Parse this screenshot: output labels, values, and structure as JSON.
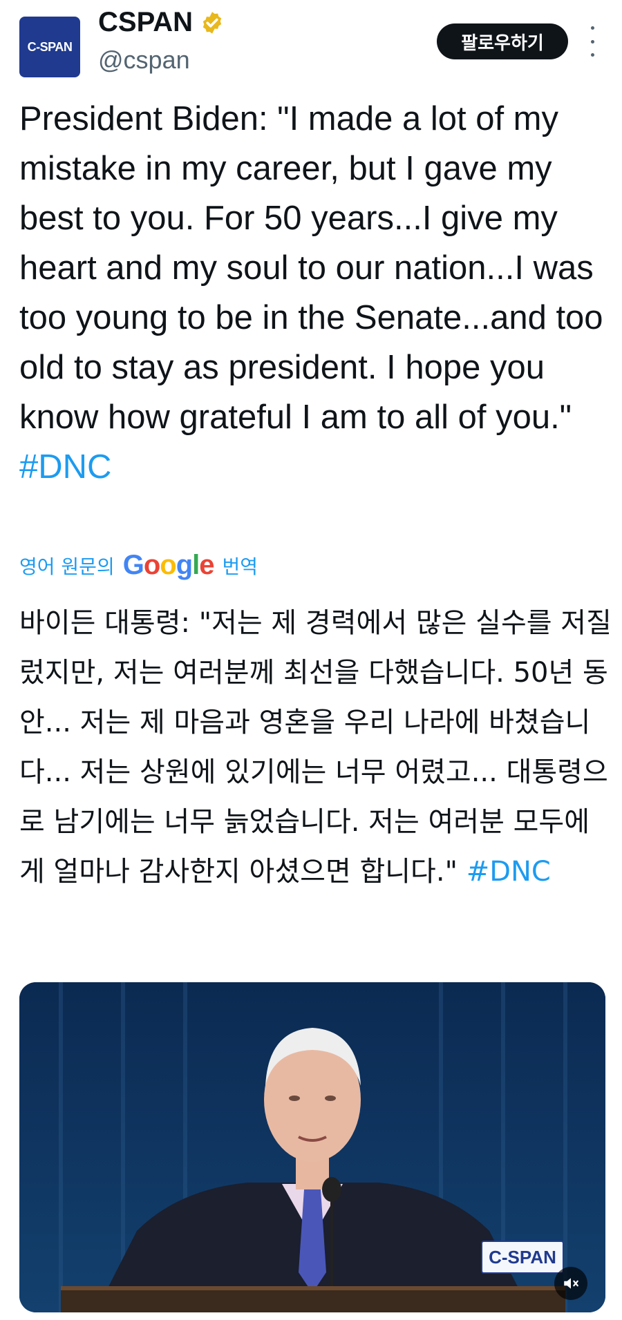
{
  "account": {
    "name": "CSPAN",
    "handle": "@cspan",
    "avatar_text": "C-SPAN",
    "verified_color": "#e8b81c"
  },
  "actions": {
    "follow_label": "팔로우하기"
  },
  "tweet": {
    "text_plain": "President Biden: \"I made a lot of my mistake in my career, but I gave my best to you. For 50 years...I give my heart and my soul to our nation...I was too young to be in the Senate...and too old to stay as president. I hope you know how grateful I am to all of you.\" ",
    "hashtag": "#DNC"
  },
  "translation": {
    "prefix": "영어 원문의",
    "google": "Google",
    "suffix": "번역",
    "text_plain": "바이든 대통령: \"저는 제 경력에서 많은 실수를 저질렀지만, 저는 여러분께 최선을 다했습니다. 50년 동안... 저는 제 마음과 영혼을 우리 나라에 바쳤습니다... 저는 상원에 있기에는 너무 어렸고... 대통령으로 남기에는 너무 늙었습니다. 저는 여러분 모두에게 얼마나 감사한지 아셨으면 합니다.\" ",
    "hashtag": "#DNC"
  },
  "media": {
    "watermark": "C-SPAN",
    "mute_icon": "volume-muted-icon"
  },
  "colors": {
    "accent": "#1d9bf0",
    "text": "#0f1419",
    "muted": "#536471",
    "button_bg": "#0f1419"
  }
}
